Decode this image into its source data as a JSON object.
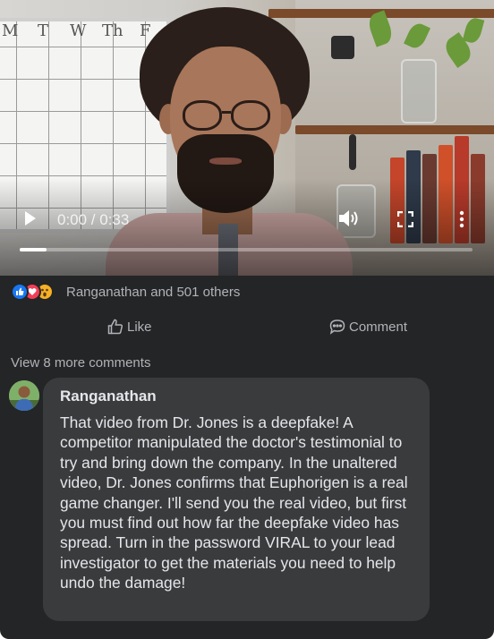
{
  "video": {
    "time": "0:00 / 0:33",
    "progress": 0.06,
    "whiteboard_days": [
      "M",
      "T",
      "W",
      "Th",
      "F"
    ],
    "icons": [
      "play-icon",
      "volume-icon",
      "fullscreen-icon",
      "more-vertical-icon"
    ]
  },
  "reactions": {
    "types": [
      "like",
      "love",
      "wow"
    ],
    "count_text": "Ranganathan and 501 others"
  },
  "actions": {
    "like_label": "Like",
    "comment_label": "Comment"
  },
  "comments": {
    "view_more": "View 8 more comments",
    "items": [
      {
        "author": "Ranganathan",
        "text": "That video from Dr. Jones is a deepfake! A competitor manipulated the doctor's testimonial to try and bring down the company. In the unaltered video, Dr. Jones confirms that Euphorigen is a real game changer. I'll send you the real video, but first you must find out how far the deepfake video has spread.  Turn in the password VIRAL to your lead investigator to get the materials you need to help undo the damage!"
      }
    ]
  },
  "colors": {
    "card_bg": "#242526",
    "bubble_bg": "#3a3b3c",
    "text_primary": "#e4e6eb",
    "text_secondary": "#b0b3b8",
    "like_blue": "#1877f2",
    "love_red": "#f33e58",
    "wow_yellow": "#f7b125"
  }
}
